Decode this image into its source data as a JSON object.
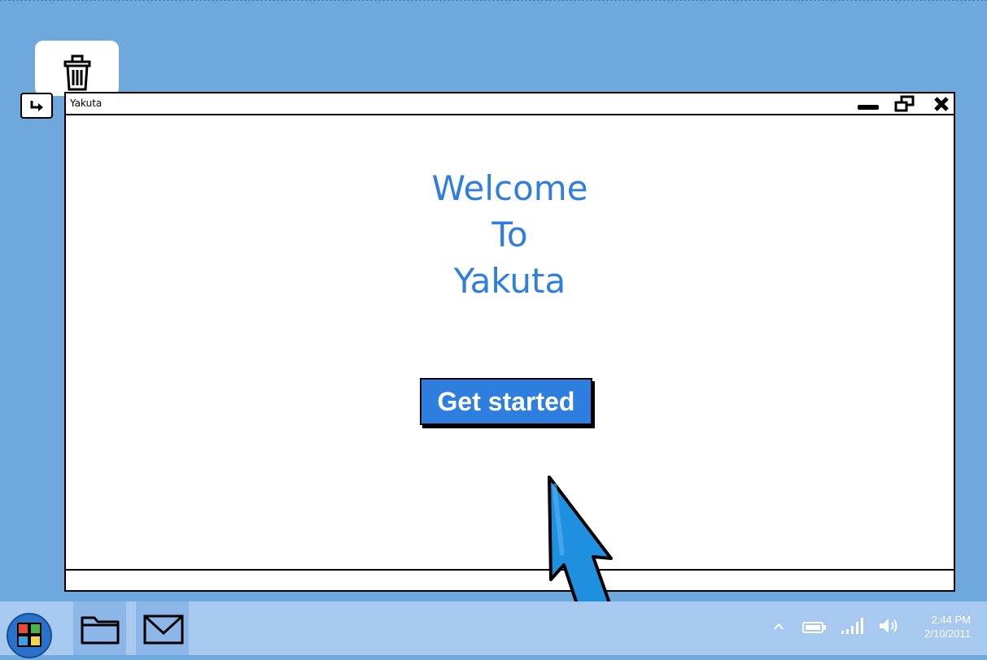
{
  "desktop": {
    "icons": [
      {
        "name": "trash",
        "icon": "trash-icon"
      }
    ],
    "shortcut_icon": "shortcut-arrow-icon"
  },
  "window": {
    "title": "Yakuta",
    "controls": {
      "minimize_icon": "minimize-icon",
      "maximize_icon": "restore-icon",
      "close_icon": "close-icon"
    },
    "welcome_lines": [
      "Welcome",
      "To",
      "Yakuta"
    ],
    "cta_label": "Get started",
    "accent_color": "#2e7ee0"
  },
  "taskbar": {
    "start_icon": "windows-start-icon",
    "apps": [
      {
        "icon": "folder-icon",
        "active": true
      },
      {
        "icon": "mail-icon",
        "active": true
      }
    ],
    "tray": {
      "icons": [
        "chevron-up-icon",
        "battery-icon",
        "signal-icon",
        "volume-icon"
      ],
      "time": "2:44 PM",
      "date": "2/10/2011"
    }
  },
  "colors": {
    "desktop_bg": "#6fa8dc",
    "taskbar_bg": "#a7c8ef",
    "cursor_fill": "#1f8fe0"
  }
}
